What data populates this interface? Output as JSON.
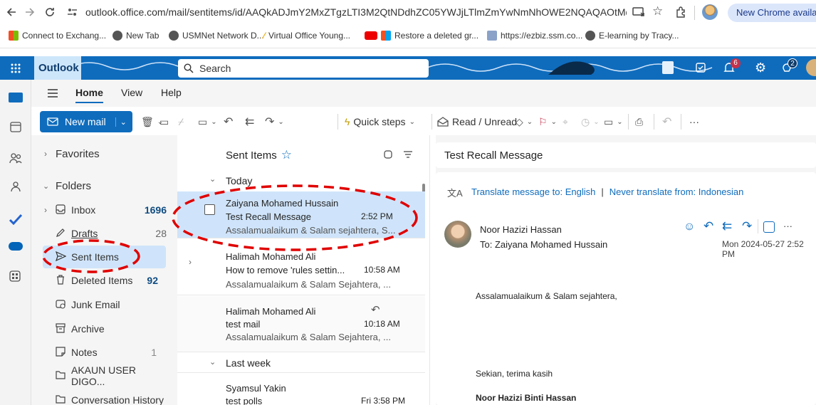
{
  "browser": {
    "url": "outlook.office.com/mail/sentitems/id/AAQkADJmY2MxZTgzLTI3M2QtNDdhZC05YWJjLTlmZmYwNmNhOWE2NQAQAOtMdE...",
    "new_chrome": "New Chrome available",
    "bookmarks": [
      "Connect to Exchang...",
      "New Tab",
      "USMNet Network D...",
      "Virtual Office Young...",
      "Restore a deleted gr...",
      "https://ezbiz.ssm.co...",
      "E-learning by Tracy..."
    ],
    "colors": {
      "accent": "#0f6cbd"
    }
  },
  "header": {
    "app_name": "Outlook",
    "search_placeholder": "Search",
    "notifications_badge": "6",
    "tips_badge": "2"
  },
  "ribbon": {
    "tabs": [
      "Home",
      "View",
      "Help"
    ],
    "new_mail": "New mail",
    "quick_steps": "Quick steps",
    "read_unread": "Read / Unread",
    "more": "···"
  },
  "folders": {
    "favorites": "Favorites",
    "folders": "Folders",
    "items": [
      {
        "label": "Inbox",
        "count": "1696"
      },
      {
        "label": "Drafts",
        "count": "28"
      },
      {
        "label": "Sent Items",
        "count": ""
      },
      {
        "label": "Deleted Items",
        "count": "92"
      },
      {
        "label": "Junk Email",
        "count": ""
      },
      {
        "label": "Archive",
        "count": ""
      },
      {
        "label": "Notes",
        "count": "1"
      },
      {
        "label": "AKAUN USER DIGO...",
        "count": ""
      },
      {
        "label": "Conversation History",
        "count": ""
      }
    ]
  },
  "list": {
    "title": "Sent Items",
    "group_today": "Today",
    "group_last_week": "Last week",
    "messages": [
      {
        "from": "Zaiyana Mohamed Hussain",
        "subject": "Test Recall Message",
        "time": "2:52 PM",
        "preview": "Assalamualaikum & Salam sejahtera, S..."
      },
      {
        "from": "Halimah Mohamed Ali",
        "subject": "How to remove 'rules settin...",
        "time": "10:58 AM",
        "preview": "Assalamualaikum & Salam Sejahtera, ..."
      },
      {
        "from": "Halimah Mohamed Ali",
        "subject": "test mail",
        "time": "10:18 AM",
        "preview": "Assalamualaikum & Salam Sejahtera, ..."
      },
      {
        "from": "Syamsul Yakin",
        "subject": "test polls",
        "time": "Fri 3:58 PM",
        "preview": ""
      }
    ]
  },
  "reading": {
    "subject": "Test Recall Message",
    "translate": "Translate message to: English",
    "never_translate": "Never translate from: Indonesian",
    "separator": "|",
    "sender": "Noor Hazizi Hassan",
    "to": "To:  Zaiyana Mohamed Hussain",
    "date": "Mon 2024-05-27 2:52 PM",
    "body_greeting": "Assalamualaikum & Salam sejahtera,",
    "body_closing": "Sekian, terima kasih",
    "signature": "Noor Hazizi Binti Hassan"
  }
}
